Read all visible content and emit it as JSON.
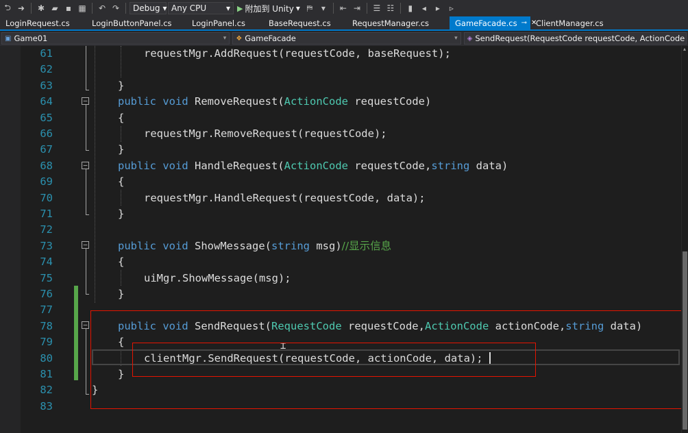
{
  "toolbar": {
    "configuration": "Debug",
    "platform": "Any CPU",
    "run_label": "附加到 Unity"
  },
  "tabs": [
    {
      "label": "LoginRequest.cs"
    },
    {
      "label": "LoginButtonPanel.cs"
    },
    {
      "label": "LoginPanel.cs"
    },
    {
      "label": "BaseRequest.cs"
    },
    {
      "label": "RequestManager.cs"
    },
    {
      "label": "GameFacade.cs",
      "active": true
    },
    {
      "label": "ClientManager.cs"
    }
  ],
  "navbar": {
    "project": "Game01",
    "class": "GameFacade",
    "member": "SendRequest(RequestCode requestCode, ActionCode action"
  },
  "code": {
    "line_numbers": [
      "61",
      "62",
      "63",
      "64",
      "65",
      "66",
      "67",
      "68",
      "69",
      "70",
      "71",
      "72",
      "73",
      "74",
      "75",
      "76",
      "77",
      "78",
      "79",
      "80",
      "81",
      "82",
      "83"
    ],
    "l61": {
      "a": "requestMgr.AddRequest(requestCode, baseRequest);"
    },
    "l63": {
      "a": "}"
    },
    "l64": {
      "kw1": "public",
      "kw2": "void",
      "name": "RemoveRequest(",
      "t1": "ActionCode",
      "rest": " requestCode)"
    },
    "l65": {
      "a": "{"
    },
    "l66": {
      "a": "requestMgr.RemoveRequest(requestCode);"
    },
    "l67": {
      "a": "}"
    },
    "l68": {
      "kw1": "public",
      "kw2": "void",
      "name": "HandleRequest(",
      "t1": "ActionCode",
      "mid": " requestCode,",
      "t2": "string",
      "rest": " data)"
    },
    "l69": {
      "a": "{"
    },
    "l70": {
      "a": "requestMgr.HandleRequest(requestCode, data);"
    },
    "l71": {
      "a": "}"
    },
    "l73": {
      "kw1": "public",
      "kw2": "void",
      "name": "ShowMessage(",
      "t1": "string",
      "rest": " msg)",
      "comment": "//显示信息"
    },
    "l74": {
      "a": "{"
    },
    "l75": {
      "a": "uiMgr.ShowMessage(msg);"
    },
    "l76": {
      "a": "}"
    },
    "l78": {
      "kw1": "public",
      "kw2": "void",
      "name": "SendRequest(",
      "t1": "RequestCode",
      "mid1": " requestCode,",
      "t2": "ActionCode",
      "mid2": " actionCode,",
      "t3": "string",
      "rest": " data)"
    },
    "l79": {
      "a": "{"
    },
    "l80": {
      "a": "clientMgr.SendRequest(requestCode, actionCode, data);"
    },
    "l81": {
      "a": "}"
    },
    "l82": {
      "a": "}"
    }
  }
}
